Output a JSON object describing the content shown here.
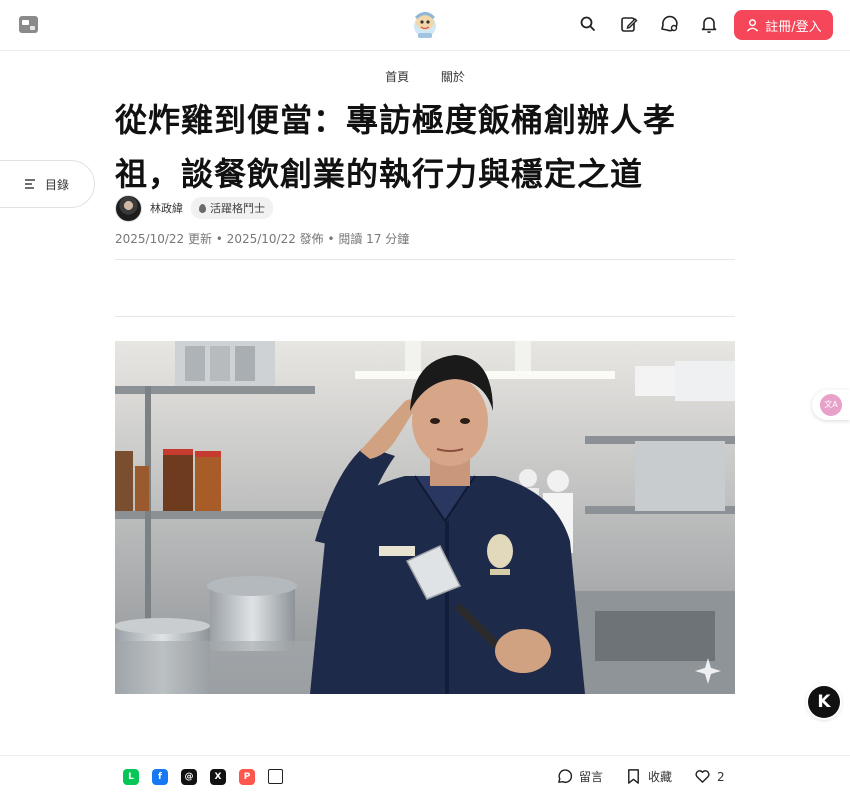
{
  "header": {
    "signin_label": "註冊/登入",
    "icons": [
      "search-icon",
      "edit-icon",
      "chat-icon",
      "bell-icon",
      "user-icon"
    ]
  },
  "breadcrumb": {
    "home": "首頁",
    "about": "關於"
  },
  "toc": {
    "label": "目錄"
  },
  "article": {
    "title_line1": "從炸雞到便當：專訪極度飯桶創辦人孝",
    "title_line2": "祖，談餐飲創業的執行力與穩定之道",
    "author": "林政緯",
    "tag": "活躍格鬥士",
    "meta": "2025/10/22 更新 • 2025/10/22 發佈 • 閱讀 17 分鐘"
  },
  "floating": {
    "k_label": "K"
  },
  "bottom": {
    "share_icons": [
      "line-icon",
      "facebook-icon",
      "threads-icon",
      "x-icon",
      "plurk-icon",
      "copy-icon"
    ],
    "comment_label": "留言",
    "bookmark_label": "收藏",
    "like_count": "2"
  },
  "colors": {
    "accent": "#f6475a",
    "text": "#111111",
    "muted": "#777777"
  }
}
